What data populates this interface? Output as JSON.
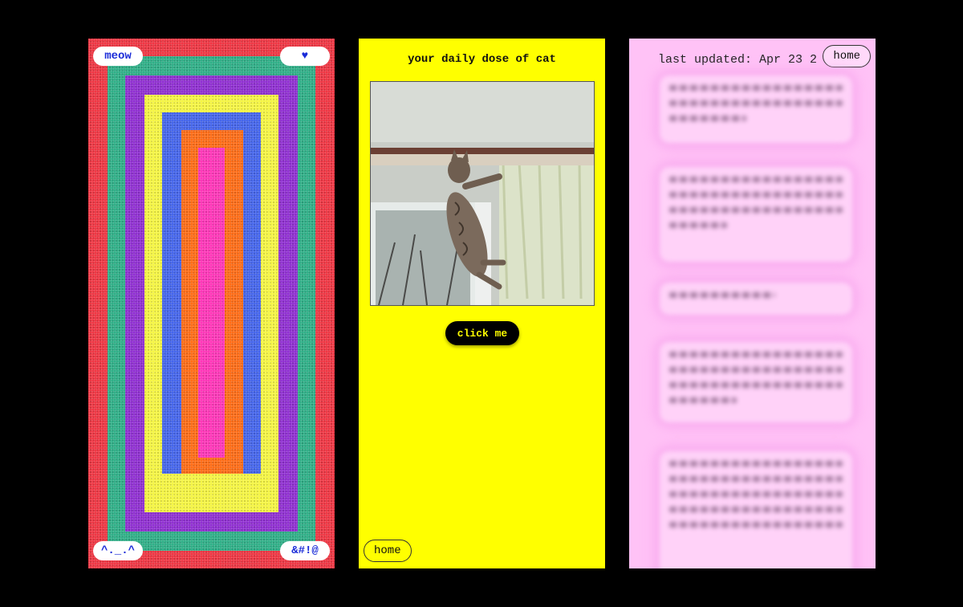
{
  "panel1": {
    "top_left_label": "meow",
    "top_right_symbol": "♥",
    "bottom_left_label": "^._.^",
    "bottom_right_label": "&#!@",
    "ring_colors": [
      "#ef3340",
      "#2cae86",
      "#f5f540",
      "#8e2cd1",
      "#ffff33",
      "#4263eb",
      "#ff6a13",
      "#ff33b8"
    ]
  },
  "panel2": {
    "title": "your daily dose of cat",
    "button_label": "click me",
    "home_label": "home",
    "background": "#ffff00"
  },
  "panel3": {
    "updated_text": "last updated: Apr 23 2",
    "home_label": "home",
    "background": "#ffc2f6"
  }
}
